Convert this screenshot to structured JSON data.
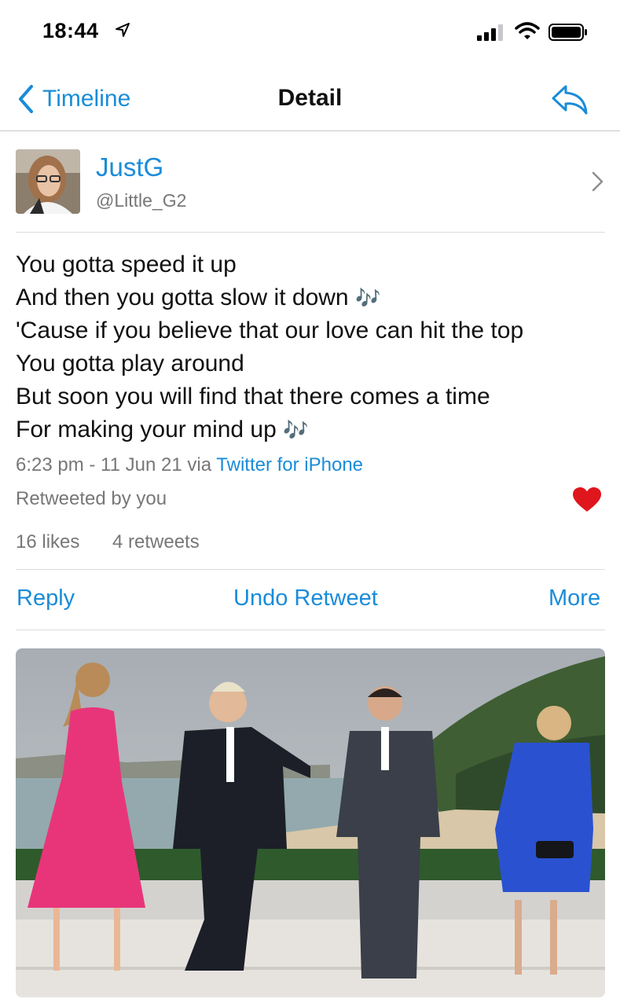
{
  "status_bar": {
    "time": "18:44"
  },
  "nav": {
    "back_label": "Timeline",
    "title": "Detail"
  },
  "author": {
    "name": "JustG",
    "handle": "@Little_G2"
  },
  "tweet": {
    "lines": [
      "You gotta speed it up",
      "And then you gotta slow it down",
      "'Cause if you believe that our love can hit the top",
      "You gotta play around",
      "But soon you will find that there comes a time",
      "For making your mind up"
    ],
    "note_emoji": "🎶"
  },
  "meta": {
    "timestamp": "6:23 pm - 11 Jun 21 via ",
    "source": "Twitter for iPhone"
  },
  "retweeted_label": "Retweeted by you",
  "stats": {
    "likes": "16 likes",
    "retweets": "4 retweets"
  },
  "actions": {
    "reply": "Reply",
    "undo_retweet": "Undo Retweet",
    "more": "More"
  },
  "colors": {
    "link": "#1a8cd8",
    "heart": "#e0161d",
    "meta_text": "#777777"
  },
  "icons": [
    "location-arrow-icon",
    "signal-icon",
    "wifi-icon",
    "battery-icon",
    "back-chevron-icon",
    "share-icon",
    "chevron-right-icon",
    "heart-icon"
  ]
}
